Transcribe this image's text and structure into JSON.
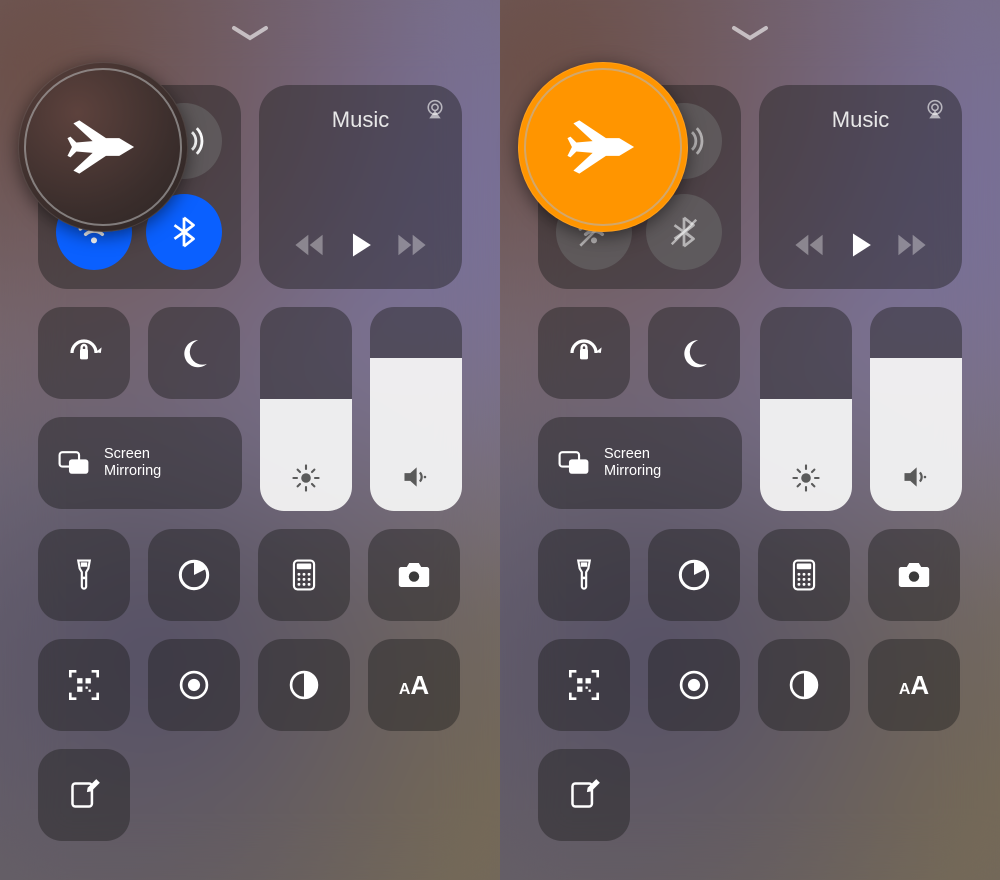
{
  "left": {
    "airplane_on": false,
    "wifi_enabled": true,
    "bluetooth_enabled": true,
    "music_label": "Music",
    "screen_mirroring_label": "Screen\nMirroring",
    "brightness_pct": 55,
    "volume_pct": 75,
    "text_size_label": "AA"
  },
  "right": {
    "airplane_on": true,
    "wifi_enabled": false,
    "bluetooth_enabled": false,
    "music_label": "Music",
    "screen_mirroring_label": "Screen\nMirroring",
    "brightness_pct": 55,
    "volume_pct": 75,
    "text_size_label": "AA"
  },
  "colors": {
    "blue": "#0a60ff",
    "orange": "#ff9500"
  }
}
